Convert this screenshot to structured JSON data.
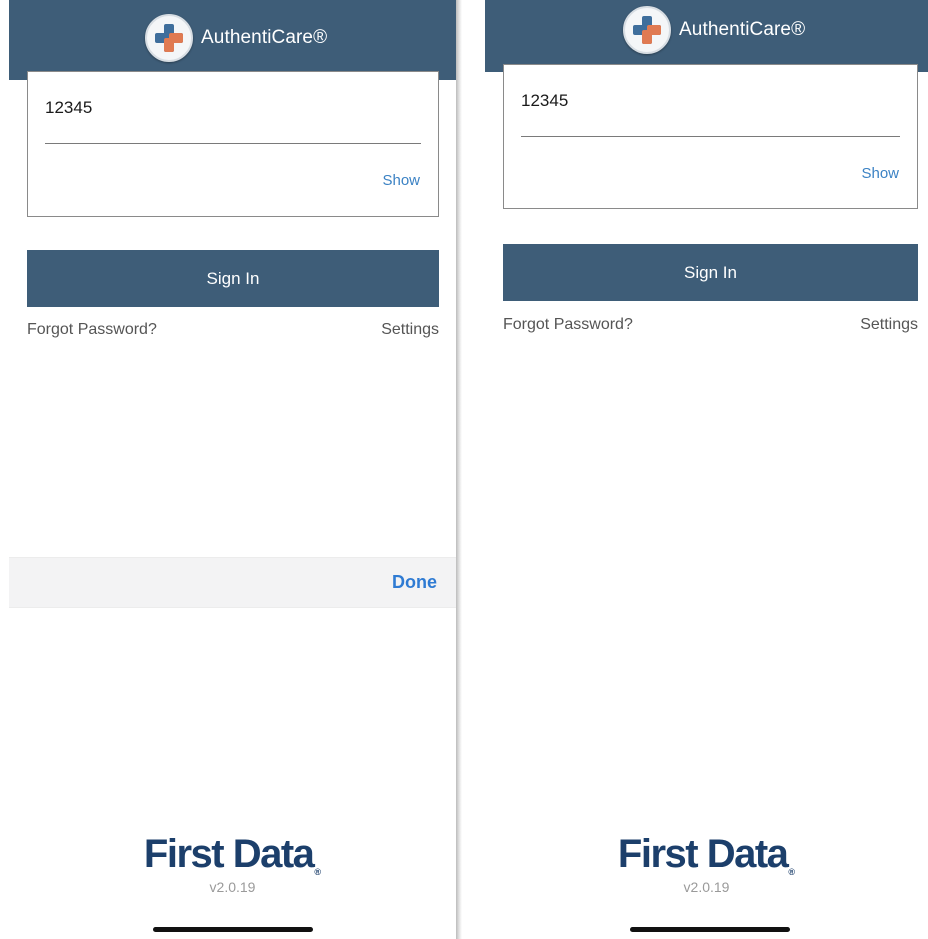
{
  "left_screen": {
    "header": {
      "app_name": "AuthentiCare®"
    },
    "password_field": {
      "value": "12345",
      "show_label": "Show"
    },
    "sign_in_label": "Sign In",
    "forgot_password_label": "Forgot Password?",
    "settings_label": "Settings",
    "keyboard_toolbar": {
      "done_label": "Done"
    },
    "footer": {
      "logo_text": "First Data",
      "registered_mark": "®",
      "version": "v2.0.19"
    }
  },
  "right_screen": {
    "header": {
      "app_name": "AuthentiCare®"
    },
    "password_field": {
      "value": "12345",
      "show_label": "Show"
    },
    "sign_in_label": "Sign In",
    "forgot_password_label": "Forgot Password?",
    "settings_label": "Settings",
    "footer": {
      "logo_text": "First Data",
      "registered_mark": "®",
      "version": "v2.0.19"
    }
  },
  "colors": {
    "header_bg": "#3e5d78",
    "button_bg": "#3e5d78",
    "link_blue": "#3b82c4",
    "done_blue": "#2f7bd3",
    "footer_logo": "#1c3f6b",
    "cross_orange": "#e07a52",
    "cross_blue": "#3e6e9c"
  },
  "icons": {
    "app_logo": "medical-cross-icon"
  }
}
